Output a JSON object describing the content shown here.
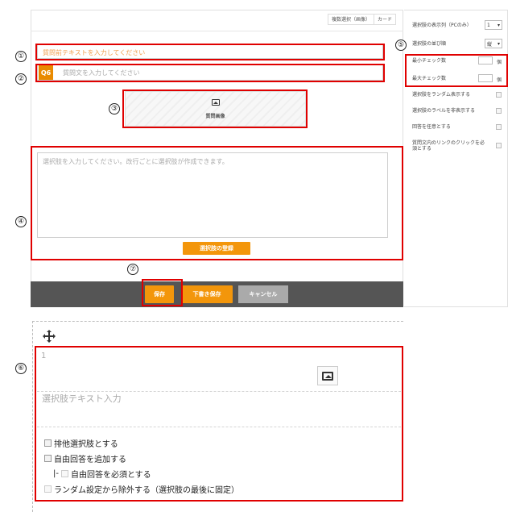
{
  "header": {
    "tabs": [
      "複数選択（画像）",
      "カード"
    ]
  },
  "editor": {
    "pre_text_placeholder": "質問前テキストを入力してください",
    "question_badge": "Q6",
    "question_placeholder": "質問文を入力してください",
    "image_label": "質問画像",
    "choices_placeholder": "選択肢を入力してください。改行ごとに選択肢が作成できます。",
    "register_label": "選択肢の登録"
  },
  "footer": {
    "save_label": "保存",
    "draft_label": "下書き保存",
    "cancel_label": "キャンセル"
  },
  "settings": {
    "columns_label": "選択肢の表示列（PCのみ）",
    "columns_value": "1",
    "order_label": "選択肢の並び順",
    "order_value": "縦",
    "min_label": "最小チェック数",
    "max_label": "最大チェック数",
    "unit": "個",
    "random_label": "選択肢をランダム表示する",
    "hide_label": "選択肢のラベルを非表示する",
    "optional_label": "回答を任意とする",
    "link_label": "質問文内のリンクのクリックを必須とする"
  },
  "choice_item": {
    "number": "1",
    "text_placeholder": "選択肢テキスト入力",
    "exclusive_label": "排他選択肢とする",
    "free_answer_label": "自由回答を追加する",
    "free_required_prefix": "|-",
    "free_required_label": "自由回答を必須とする",
    "random_exclude_label": "ランダム設定から除外する（選択肢の最後に固定）"
  },
  "callouts": [
    "①",
    "②",
    "③",
    "④",
    "⑤",
    "⑥",
    "⑦"
  ],
  "colors": {
    "accent": "#f3960b",
    "badge": "#e98a00",
    "callout_border": "#e00000",
    "footer_bar": "#555555"
  }
}
